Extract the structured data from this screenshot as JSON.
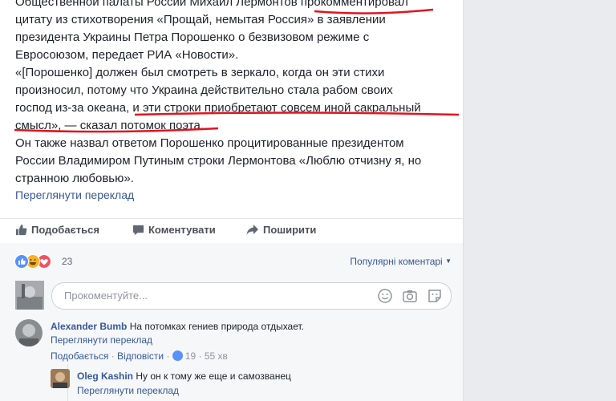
{
  "post": {
    "lines": [
      "Общественной палаты России Михаил Лермонтов прокомментировал",
      "цитату из стихотворения «Прощай, немытая Россия» в заявлении",
      "президента Украины Петра Порошенко о безвизовом режиме с",
      "Евросоюзом, передает РИА «Новости».",
      "«[Порошенко] должен был смотреть в зеркало, когда он эти стихи",
      "произносил, потому что Украина действительно стала рабом своих",
      "господ из-за океана, и эти строки приобретают совсем иной сакральный",
      "смысл», — сказал потомок поэта.",
      "Он также назвал ответом Порошенко процитированные президентом",
      "России Владимиром Путиным строки Лермонтова «Люблю отчизну я, но",
      "странною любовью»."
    ],
    "translate_label": "Переглянути переклад"
  },
  "actions": {
    "like": "Подобається",
    "comment": "Коментувати",
    "share": "Поширити"
  },
  "reactions": {
    "count": "23",
    "sort_label": "Популярні коментарі",
    "colors": {
      "like": "#5890ff",
      "haha": "#f7b125",
      "love": "#f25268"
    }
  },
  "composer": {
    "placeholder": "Прокоментуйте..."
  },
  "comments": [
    {
      "author": "Alexander Bumb",
      "text": "На потомках гениев природа отдыхает.",
      "translate": "Переглянути переклад",
      "like": "Подобається",
      "reply": "Відповісти",
      "likes": "19",
      "time": "55 хв"
    },
    {
      "author": "Oleg Kashin",
      "text": "Ну он к тому же еще и самозванец",
      "translate": "Переглянути переклад"
    }
  ],
  "underline_color": "#e0141e"
}
